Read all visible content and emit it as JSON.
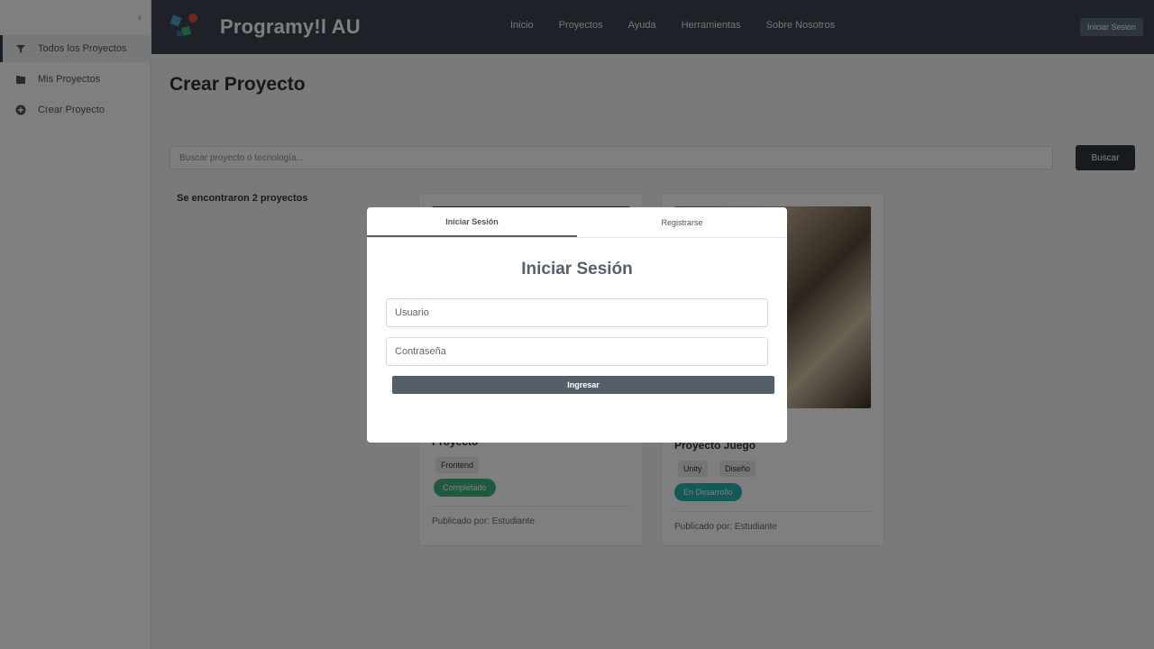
{
  "sidebar": {
    "collapse_icon": "chevron-left-icon",
    "items": [
      {
        "label": "Todos los Proyectos",
        "icon": "filter-icon"
      },
      {
        "label": "Mis Proyectos",
        "icon": "folder-icon"
      },
      {
        "label": "Crear Proyecto",
        "icon": "plus-circle-icon"
      }
    ]
  },
  "header": {
    "brand": "Programy!l AU",
    "nav": [
      "Inicio",
      "Proyectos",
      "Ayuda",
      "Herramientas",
      "Sobre Nosotros"
    ],
    "user_button": "Iniciar Sesión"
  },
  "main": {
    "title": "Crear Proyecto",
    "search_placeholder": "Buscar proyecto o tecnología...",
    "search_button": "Buscar",
    "found_text": "Se encontraron 2 proyectos"
  },
  "cards": [
    {
      "title": "Proyecto",
      "tags": [
        "Frontend"
      ],
      "status": "Completado",
      "author": "Publicado por: Estudiante"
    },
    {
      "title": "Proyecto Juego",
      "tags": [
        "Unity",
        "Diseño"
      ],
      "status": "En Desarrollo",
      "author": "Publicado por: Estudiante"
    }
  ],
  "modal": {
    "tabs": [
      "Iniciar Sesión",
      "Registrarse"
    ],
    "heading": "Iniciar Sesión",
    "username_placeholder": "Usuario",
    "password_placeholder": "Contraseña",
    "submit_label": "Ingresar"
  },
  "colors": {
    "topbar": "#3d4451",
    "button_primary": "#555f69",
    "pill_green": "#3fb27f",
    "pill_teal": "#25b5b0"
  }
}
